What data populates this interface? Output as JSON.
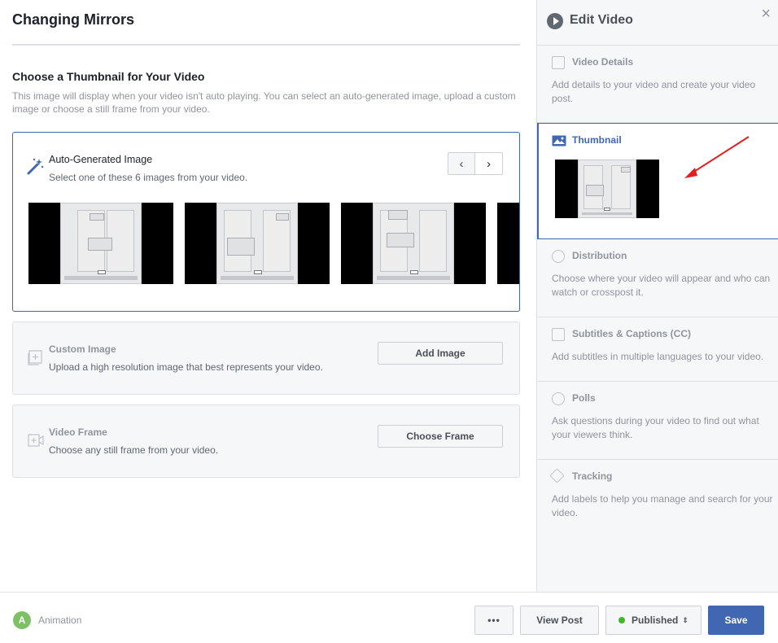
{
  "page": {
    "title": "Changing Mirrors"
  },
  "thumbnail_section": {
    "heading": "Choose a Thumbnail for Your Video",
    "description": "This image will display when your video isn't auto playing. You can select an auto-generated image, upload a custom image or choose a still frame from your video."
  },
  "auto_generated": {
    "title": "Auto-Generated Image",
    "subtitle": "Select one of these 6 images from your video.",
    "prev_glyph": "‹",
    "next_glyph": "›"
  },
  "custom_image": {
    "title": "Custom Image",
    "subtitle": "Upload a high resolution image that best represents your video.",
    "button": "Add Image"
  },
  "video_frame": {
    "title": "Video Frame",
    "subtitle": "Choose any still frame from your video.",
    "button": "Choose Frame"
  },
  "sidebar": {
    "title": "Edit Video",
    "close_glyph": "×",
    "items": [
      {
        "label": "Video Details",
        "desc": "Add details to your video and create your video post."
      },
      {
        "label": "Thumbnail",
        "desc": ""
      },
      {
        "label": "Distribution",
        "desc": "Choose where your video will appear and who can watch or crosspost it."
      },
      {
        "label": "Subtitles & Captions (CC)",
        "desc": "Add subtitles in multiple languages to your video."
      },
      {
        "label": "Polls",
        "desc": "Ask questions during your video to find out what your viewers think."
      },
      {
        "label": "Tracking",
        "desc": "Add labels to help you manage and search for your video."
      }
    ]
  },
  "footer": {
    "avatar_letter": "A",
    "page_name": "Animation",
    "more_glyph": "•••",
    "view_post": "View Post",
    "status": "Published",
    "status_glyph": "⇕",
    "save": "Save"
  },
  "colors": {
    "accent": "#4267b2",
    "published_dot": "#42b72a",
    "arrow": "#e02020"
  }
}
